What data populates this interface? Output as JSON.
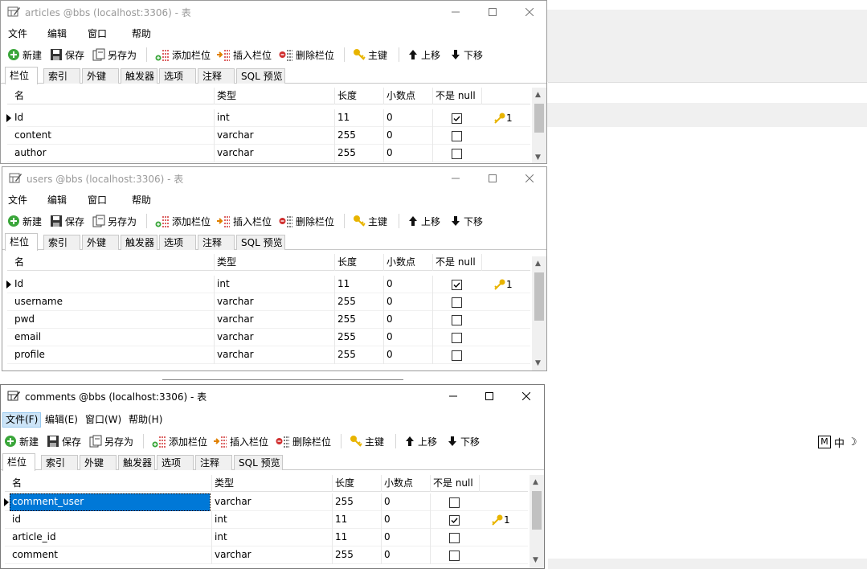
{
  "menu": {
    "file": "文件",
    "edit": "编辑",
    "window": "窗口",
    "help": "帮助"
  },
  "menu_active": {
    "file": "文件(F)",
    "edit": "编辑(E)",
    "window": "窗口(W)",
    "help": "帮助(H)"
  },
  "toolbar": {
    "new": "新建",
    "save": "保存",
    "save_as": "另存为",
    "add_field": "添加栏位",
    "insert_field": "插入栏位",
    "delete_field": "删除栏位",
    "primary_key": "主键",
    "move_up": "上移",
    "move_down": "下移"
  },
  "tabs": [
    "栏位",
    "索引",
    "外键",
    "触发器",
    "选项",
    "注释",
    "SQL 预览"
  ],
  "columns": [
    "名",
    "类型",
    "长度",
    "小数点",
    "不是 null"
  ],
  "windows": [
    {
      "title": "articles @bbs (localhost:3306) - 表",
      "rows": [
        {
          "name": "Id",
          "type": "int",
          "length": "11",
          "decimals": "0",
          "not_null": true,
          "key": "1"
        },
        {
          "name": "content",
          "type": "varchar",
          "length": "255",
          "decimals": "0",
          "not_null": false,
          "key": ""
        },
        {
          "name": "author",
          "type": "varchar",
          "length": "255",
          "decimals": "0",
          "not_null": false,
          "key": ""
        }
      ]
    },
    {
      "title": "users @bbs (localhost:3306) - 表",
      "rows": [
        {
          "name": "Id",
          "type": "int",
          "length": "11",
          "decimals": "0",
          "not_null": true,
          "key": "1"
        },
        {
          "name": "username",
          "type": "varchar",
          "length": "255",
          "decimals": "0",
          "not_null": false,
          "key": ""
        },
        {
          "name": "pwd",
          "type": "varchar",
          "length": "255",
          "decimals": "0",
          "not_null": false,
          "key": ""
        },
        {
          "name": "email",
          "type": "varchar",
          "length": "255",
          "decimals": "0",
          "not_null": false,
          "key": ""
        },
        {
          "name": "profile",
          "type": "varchar",
          "length": "255",
          "decimals": "0",
          "not_null": false,
          "key": ""
        }
      ]
    },
    {
      "title": "comments @bbs (localhost:3306) - 表",
      "rows": [
        {
          "name": "comment_user",
          "type": "varchar",
          "length": "255",
          "decimals": "0",
          "not_null": false,
          "key": ""
        },
        {
          "name": "id",
          "type": "int",
          "length": "11",
          "decimals": "0",
          "not_null": true,
          "key": "1"
        },
        {
          "name": "article_id",
          "type": "int",
          "length": "11",
          "decimals": "0",
          "not_null": false,
          "key": ""
        },
        {
          "name": "comment",
          "type": "varchar",
          "length": "255",
          "decimals": "0",
          "not_null": false,
          "key": ""
        }
      ]
    }
  ],
  "ime": {
    "mode": "M",
    "lang": "中",
    "moon": "☽"
  },
  "colors": {
    "selection": "#0078d7",
    "menu_highlight": "#cce4f7",
    "key_icon": "#e8b400",
    "new_icon": "#3aa63a",
    "delete_icon": "#d03030"
  }
}
